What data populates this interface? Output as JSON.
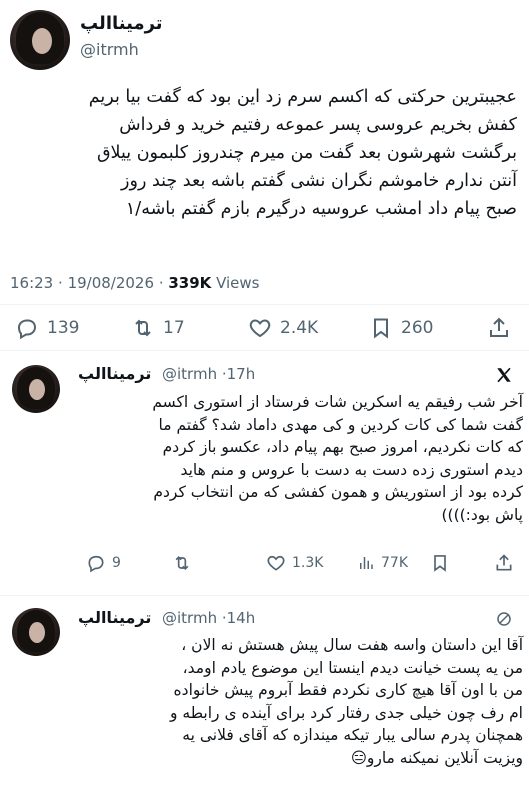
{
  "main_tweet": {
    "display_name": "ترمیناالپ",
    "handle": "@itrmh",
    "text_lines": [
      "عجیبترین حرکتی که اکسم سرم زد این بود که گفت بیا بریم",
      "کفش بخریم عروسی پسر عموعه رفتیم خرید و فرداش",
      "برگشت شهرشون بعد گفت من میرم چندروز کلبمون ییلاق",
      "آنتن ندارم خاموشم نگران نشی گفتم باشه بعد چند روز",
      "صبح پیام داد امشب عروسیه درگیرم بازم گفتم باشه/۱"
    ],
    "time": "16:23",
    "date": "19/08/2026",
    "views_count": "339K",
    "views_label": "Views",
    "stats": {
      "replies": "139",
      "retweets": "17",
      "likes": "2.4K",
      "bookmarks": "260"
    }
  },
  "replies": [
    {
      "display_name": "ترمیناالپ",
      "handle": "@itrmh",
      "time_ago": "17h",
      "badge_icon": "x-logo-icon",
      "text_lines": [
        "آخر شب رفیقم یه اسکرین شات فرستاد از استوری اکسم",
        "گفت شما کی کات کردین و کی مهدی داماد شد؟ گفتم ما",
        "که کات نکردیم، امروز صبح بهم پیام داد، عکسو باز کردم",
        "دیدم استوری زده دست به دست با عروس و منم هاید",
        "کرده بود از استوریش و همون کفشی که من انتخاب کردم",
        "پاش بود:))))"
      ],
      "stats": {
        "replies": "9",
        "retweets": "",
        "likes": "1.3K",
        "views": "77K"
      }
    },
    {
      "display_name": "ترمیناالپ",
      "handle": "@itrmh",
      "time_ago": "14h",
      "badge_icon": "no-entry-icon",
      "text_lines": [
        "آقا این داستان واسه هفت سال پیش هستش نه الان ،",
        "من یه پست خیانت دیدم اینستا این موضوع یادم اومد،",
        "من با اون آقا هیچ کاری نکردم فقط آبروم پیش خانواده",
        "ام رف چون خیلی جدی رفتار کرد برای آینده ی رابطه و",
        "همچنان پدرم سالی یبار تیکه میندازه که آقای فلانی یه",
        "ویزیت آنلاین نمیکنه مارو😑"
      ]
    }
  ],
  "colors": {
    "text": "#0f1419",
    "secondary": "#536471",
    "divider": "#eff3f4"
  }
}
